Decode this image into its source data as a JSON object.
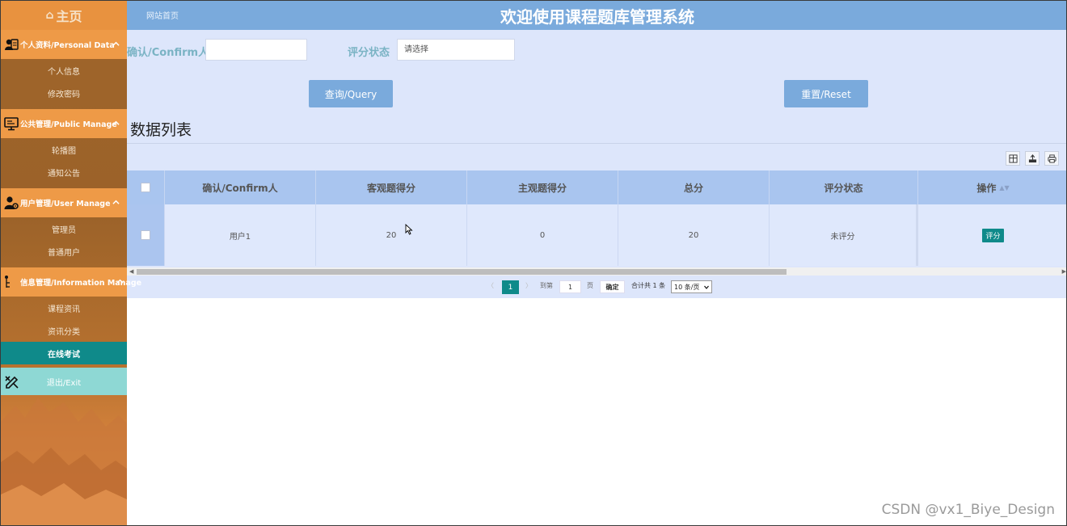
{
  "sidebar": {
    "home_label": "主页",
    "groups": [
      {
        "label": "个人资料/Personal Data",
        "icon": "user-card-icon",
        "items": [
          "个人信息",
          "修改密码"
        ]
      },
      {
        "label": "公共管理/Public Manage",
        "icon": "monitor-icon",
        "items": [
          "轮播图",
          "通知公告"
        ]
      },
      {
        "label": "用户管理/User Manage",
        "icon": "user-gear-icon",
        "items": [
          "管理员",
          "普通用户"
        ]
      },
      {
        "label": "信息管理/Information Manage",
        "icon": "info-tree-icon",
        "items": [
          "课程资讯",
          "资讯分类",
          "在线考试"
        ]
      }
    ],
    "active_item": "在线考试",
    "exit_label": "退出/Exit"
  },
  "header": {
    "crumb": "网站首页",
    "title": "欢迎使用课程题库管理系统"
  },
  "search": {
    "confirm_label": "确认/Confirm人",
    "confirm_value": "",
    "status_label": "评分状态",
    "status_placeholder": "请选择",
    "query_button": "查询/Query",
    "reset_button": "重置/Reset"
  },
  "list": {
    "title": "数据列表",
    "columns": [
      "确认/Confirm人",
      "客观题得分",
      "主观题得分",
      "总分",
      "评分状态",
      "操作"
    ],
    "rows": [
      {
        "confirm": "用户1",
        "objective": "20",
        "subjective": "0",
        "total": "20",
        "status": "未评分",
        "action": "评分"
      }
    ]
  },
  "pagination": {
    "current_page": "1",
    "goto_label": "到第",
    "goto_value": "1",
    "page_unit": "页",
    "confirm": "确定",
    "total": "合计共 1 条",
    "page_size": "10 条/页"
  },
  "watermark": "CSDN @vx1_Biye_Design",
  "colors": {
    "header": "#7aaadc",
    "sidebar_group": "#ee9a47",
    "active": "#0f8a8a",
    "main_bg": "#dde6fb",
    "exit": "#8ed8d4"
  }
}
